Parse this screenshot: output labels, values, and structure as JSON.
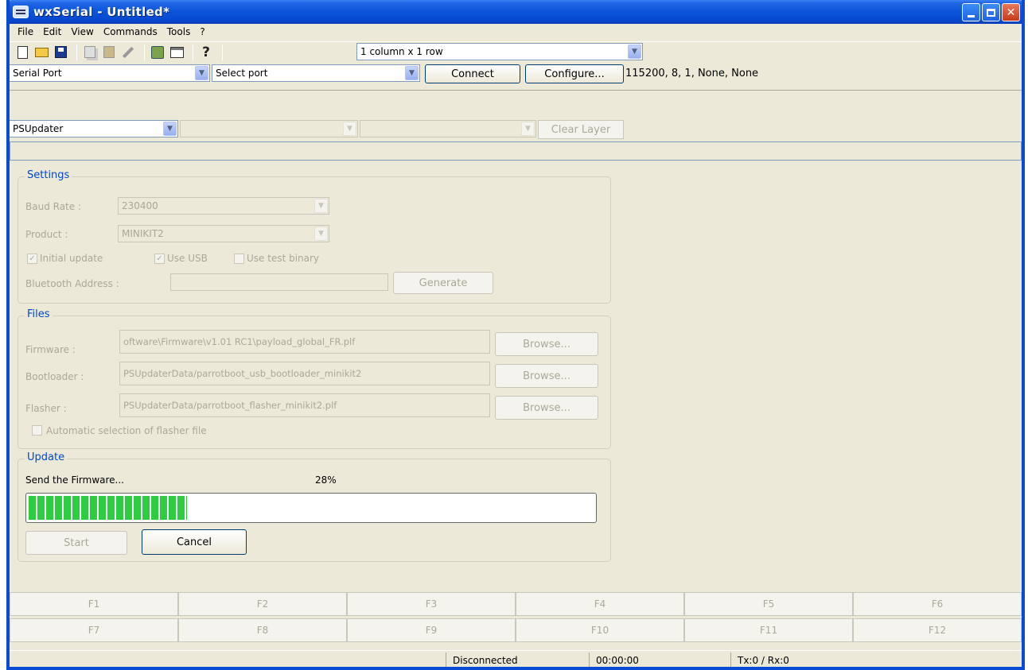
{
  "window": {
    "title": "wxSerial - Untitled*"
  },
  "menu": [
    "File",
    "Edit",
    "View",
    "Commands",
    "Tools",
    "?"
  ],
  "toolbar": {
    "layout_select": "1 column x 1 row"
  },
  "serial": {
    "type_select": "Serial Port",
    "port_select": "Select port",
    "connect_label": "Connect",
    "configure_label": "Configure...",
    "settings_text": "115200, 8, 1, None, None"
  },
  "layer": {
    "plugin_select": "PSUpdater",
    "clear_label": "Clear Layer"
  },
  "settings": {
    "title": "Settings",
    "baud_label": "Baud Rate :",
    "baud_value": "230400",
    "product_label": "Product :",
    "product_value": "MINIKIT2",
    "initial_update": "Initial update",
    "use_usb": "Use USB",
    "use_test": "Use test binary",
    "bt_label": "Bluetooth Address :",
    "generate_label": "Generate"
  },
  "files": {
    "title": "Files",
    "firmware_label": "Firmware :",
    "firmware_value": "oftware\\Firmware\\v1.01 RC1\\payload_global_FR.plf",
    "bootloader_label": "Bootloader :",
    "bootloader_value": "PSUpdaterData/parrotboot_usb_bootloader_minikit2",
    "flasher_label": "Flasher :",
    "flasher_value": "PSUpdaterData/parrotboot_flasher_minikit2.plf",
    "browse_label": "Browse...",
    "auto_select": "Automatic selection of flasher file"
  },
  "update": {
    "title": "Update",
    "status": "Send the Firmware...",
    "percent_text": "28%",
    "progress": 0.28,
    "start_label": "Start",
    "cancel_label": "Cancel"
  },
  "fkeys_row1": [
    "F1",
    "F2",
    "F3",
    "F4",
    "F5",
    "F6"
  ],
  "fkeys_row2": [
    "F7",
    "F8",
    "F9",
    "F10",
    "F11",
    "F12"
  ],
  "status": {
    "connection": "Disconnected",
    "time": "00:00:00",
    "traffic": "Tx:0 / Rx:0"
  },
  "colors": {
    "titlebar": "#0a54d8",
    "progress": "#2ecc40",
    "group_title": "#0046d5"
  },
  "icons": [
    "new-icon",
    "open-icon",
    "save-icon",
    "copy-icon",
    "paste-icon",
    "edit-icon",
    "configure-icon",
    "terminal-icon",
    "help-icon"
  ]
}
